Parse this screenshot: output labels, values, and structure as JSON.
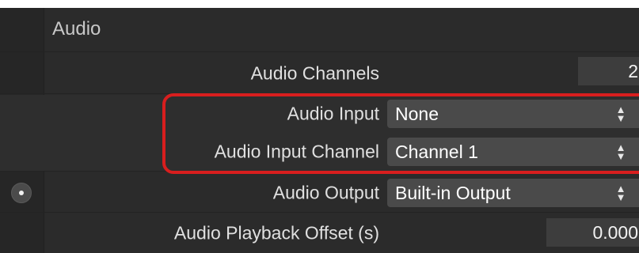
{
  "section": {
    "title": "Audio"
  },
  "rows": {
    "channels": {
      "label": "Audio Channels",
      "value": "2"
    },
    "input": {
      "label": "Audio Input",
      "value": "None"
    },
    "input_channel": {
      "label": "Audio Input Channel",
      "value": "Channel 1"
    },
    "output": {
      "label": "Audio Output",
      "value": "Built-in Output"
    },
    "playback_offset": {
      "label": "Audio Playback Offset (s)",
      "value": "0.000"
    }
  },
  "icons": {
    "select_arrows": "up-down-chevron-icon",
    "row_indicator": "radio-dot-icon"
  },
  "colors": {
    "panel_bg": "#2b2b2b",
    "field_bg": "#4a4a4a",
    "highlight": "#d81e1e"
  }
}
